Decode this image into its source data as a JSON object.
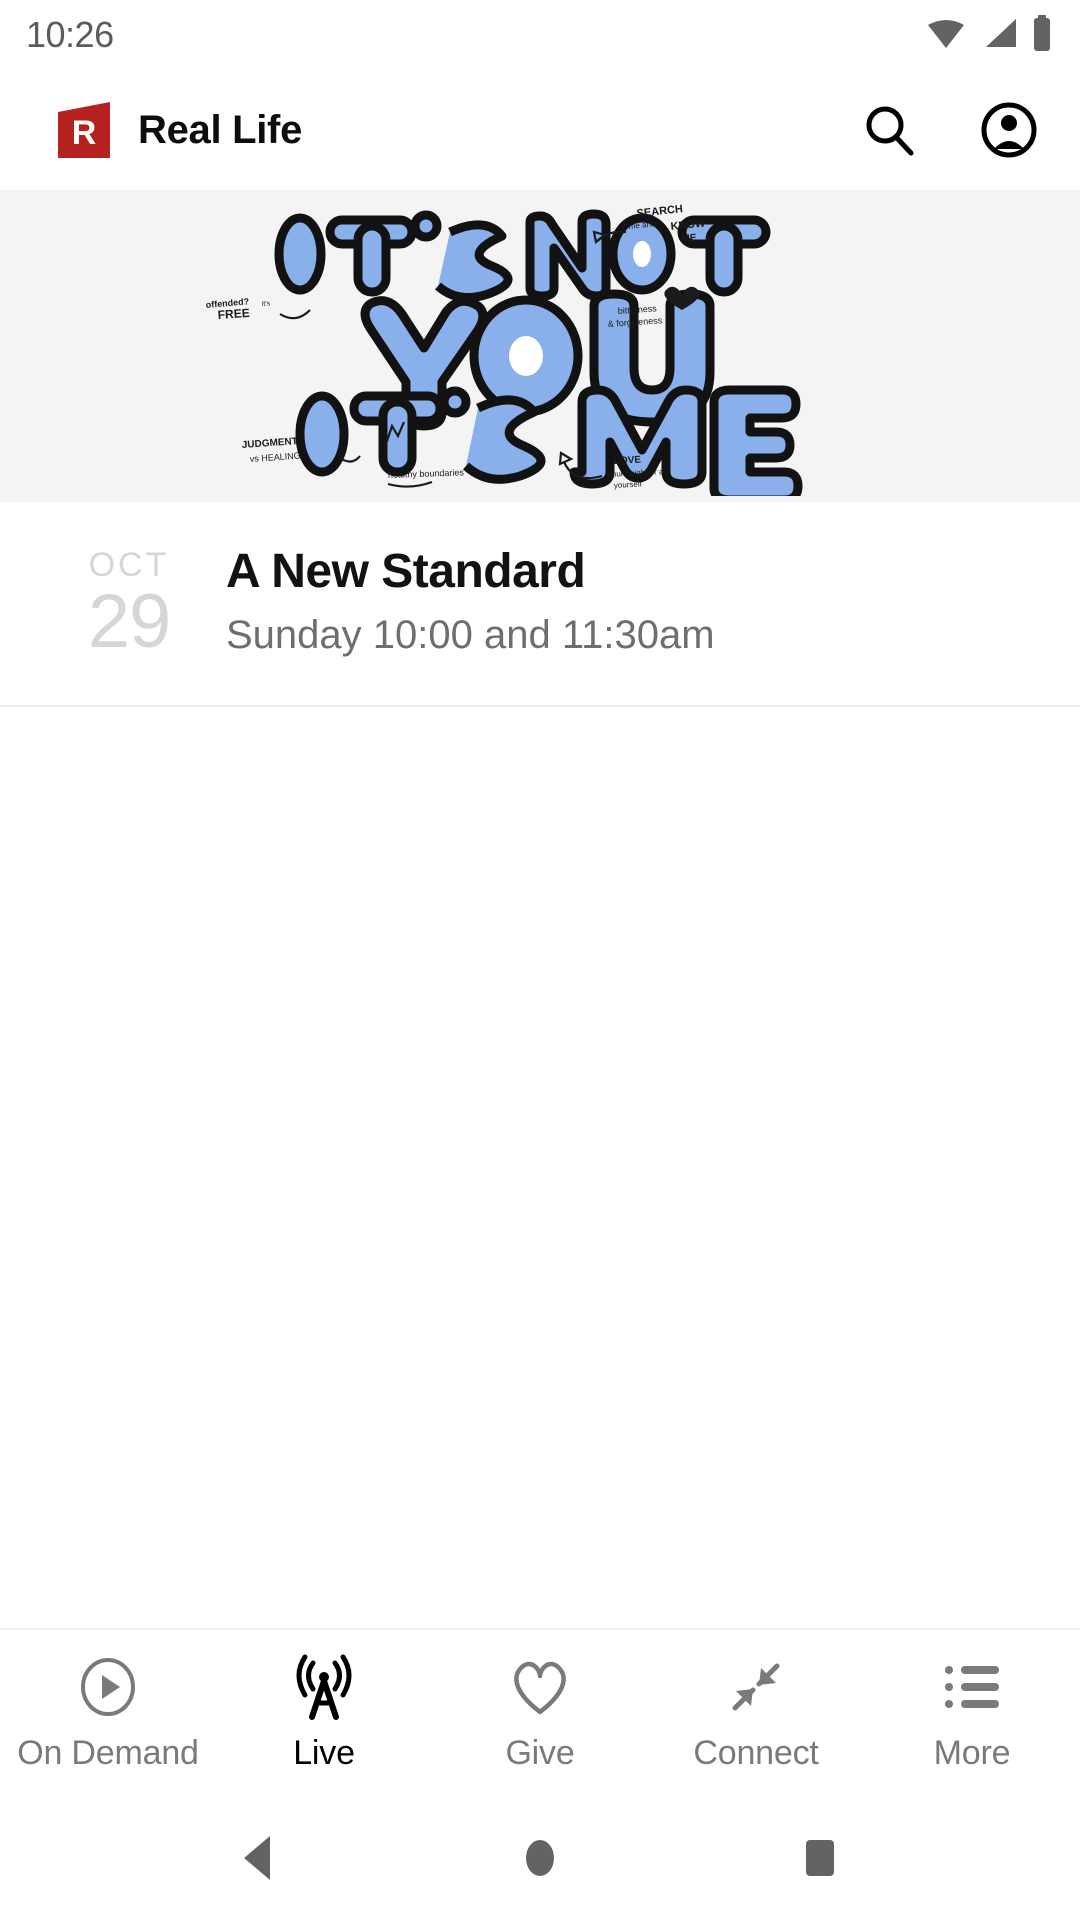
{
  "status_bar": {
    "time": "10:26",
    "icons": [
      "wifi-icon",
      "cellular-signal-icon",
      "battery-icon"
    ]
  },
  "app_bar": {
    "logo": "real-life-r-logo",
    "logo_color": "#b5211f",
    "title": "Real Life",
    "actions": [
      {
        "name": "search-icon",
        "label": "Search"
      },
      {
        "name": "account-circle-icon",
        "label": "Account"
      }
    ]
  },
  "hero": {
    "background": "#f4f4f4",
    "artwork_title": "IT'S NOT YOU IT'S ME",
    "lines": [
      "IT'S NOT",
      "YOU",
      "IT'S ME"
    ],
    "letter_fill": "#8ab0ec",
    "letter_outline": "#111827",
    "annotations": [
      {
        "text": "SEARCH me and KNOW ME",
        "position": "top-right"
      },
      {
        "text": "offended? it's FREE",
        "position": "left"
      },
      {
        "text": "bitterness & forgiveness",
        "position": "right"
      },
      {
        "text": "JUDGMENT vs HEALING",
        "position": "bottom-left"
      },
      {
        "text": "healthy boundaries",
        "position": "bottom-center"
      },
      {
        "text": "LOVE your neighbor as yourself",
        "position": "bottom-right"
      }
    ]
  },
  "event": {
    "month": "OCT",
    "day": "29",
    "title": "A New Standard",
    "subtitle": "Sunday 10:00 and 11:30am"
  },
  "tab_bar": {
    "active_index": 1,
    "tabs": [
      {
        "label": "On Demand",
        "icon": "play-circle-icon"
      },
      {
        "label": "Live",
        "icon": "broadcast-tower-icon"
      },
      {
        "label": "Give",
        "icon": "heart-icon"
      },
      {
        "label": "Connect",
        "icon": "arrows-inward-icon"
      },
      {
        "label": "More",
        "icon": "list-icon"
      }
    ]
  },
  "system_nav": {
    "buttons": [
      {
        "name": "back-button",
        "icon": "triangle-left-icon"
      },
      {
        "name": "home-button",
        "icon": "circle-icon"
      },
      {
        "name": "recents-button",
        "icon": "square-icon"
      }
    ]
  }
}
